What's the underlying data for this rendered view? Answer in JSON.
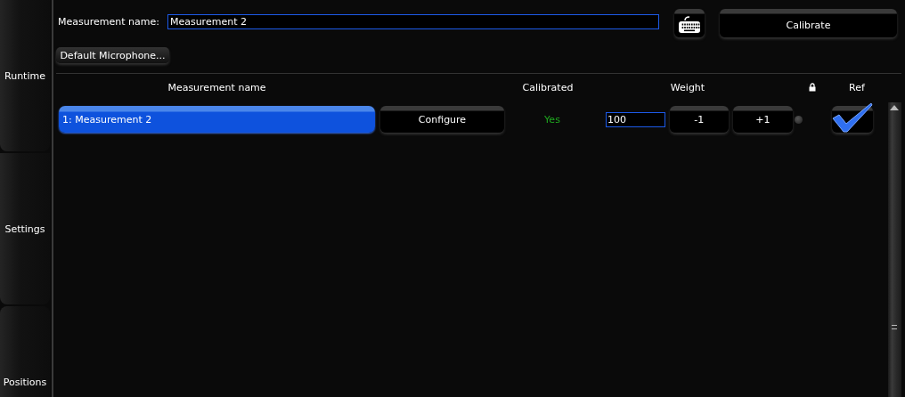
{
  "sidebar": {
    "tabs": [
      {
        "label": "Runtime"
      },
      {
        "label": "Settings"
      },
      {
        "label": "Positions"
      }
    ]
  },
  "measurement_name": {
    "label": "Measurement name:",
    "value": "Measurement 2"
  },
  "calibrate_button": "Calibrate",
  "microphone_button": "Default Microphone...",
  "table": {
    "columns": [
      "Measurement name",
      "Calibrated",
      "Weight",
      "Ref"
    ],
    "rows": [
      {
        "name": "1: Measurement 2",
        "selected": true,
        "configure": "Configure",
        "calibrated": "Yes",
        "weight": "100",
        "minus": "-1",
        "plus": "+1",
        "ref": true
      }
    ]
  }
}
